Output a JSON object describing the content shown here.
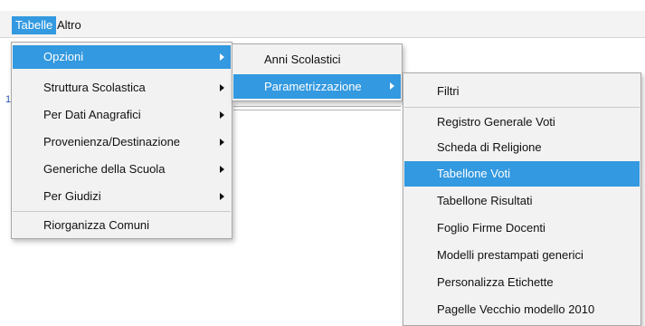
{
  "menubar": {
    "items": [
      "Tabelle",
      "Altro"
    ]
  },
  "background": {
    "fragment": "1"
  },
  "menu_tabelle": {
    "items": [
      "Opzioni",
      "Struttura Scolastica",
      "Per Dati Anagrafici",
      "Provenienza/Destinazione",
      "Generiche della Scuola",
      "Per Giudizi",
      "Riorganizza Comuni"
    ]
  },
  "menu_opzioni": {
    "items": [
      "Anni Scolastici",
      "Parametrizzazione"
    ]
  },
  "menu_parametrizzazione": {
    "items": [
      "Filtri",
      "Registro Generale Voti",
      "Scheda di Religione",
      "Tabellone Voti",
      "Tabellone Risultati",
      "Foglio Firme Docenti",
      "Modelli prestampati generici",
      "Personalizza Etichette",
      "Pagelle Vecchio modello 2010"
    ]
  }
}
